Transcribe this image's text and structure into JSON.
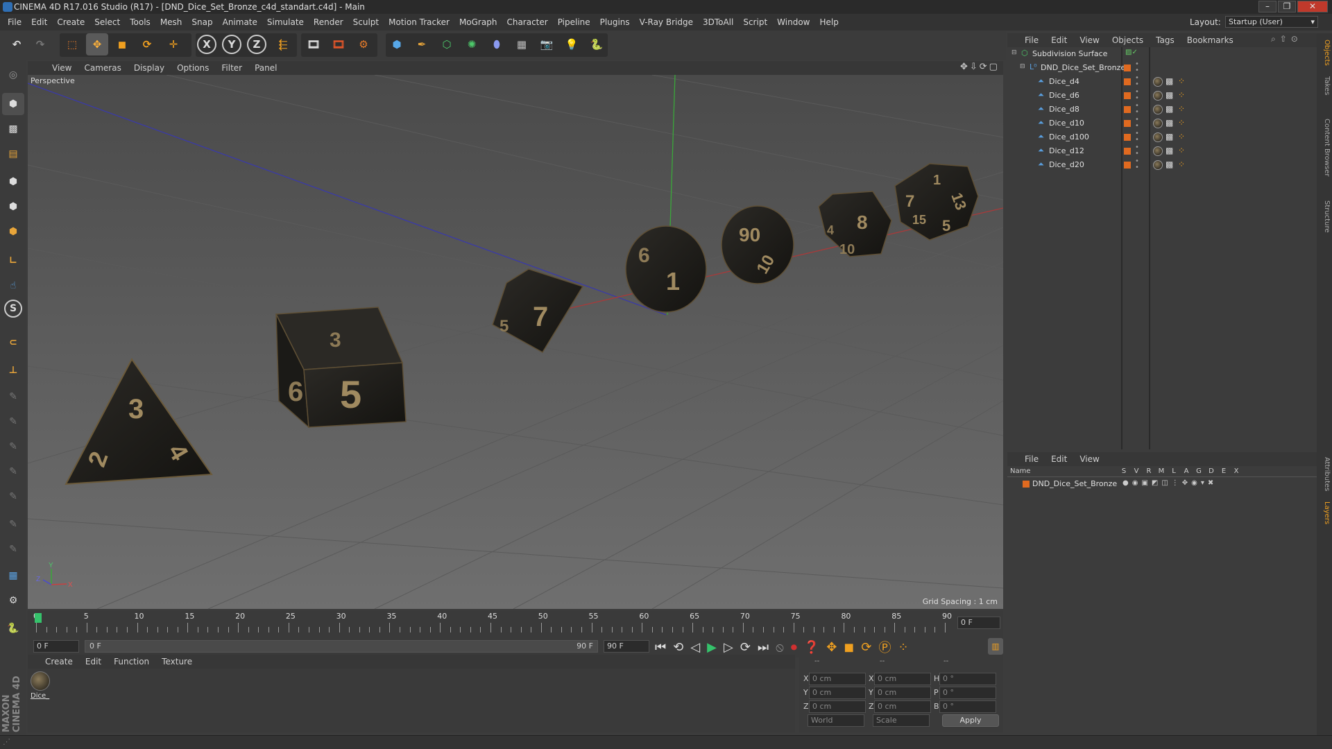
{
  "window": {
    "title": "CINEMA 4D R17.016 Studio (R17) - [DND_Dice_Set_Bronze_c4d_standart.c4d] - Main",
    "minimize": "–",
    "maximize": "❐",
    "close": "✕"
  },
  "menu": [
    "File",
    "Edit",
    "Create",
    "Select",
    "Tools",
    "Mesh",
    "Snap",
    "Animate",
    "Simulate",
    "Render",
    "Sculpt",
    "Motion Tracker",
    "MoGraph",
    "Character",
    "Pipeline",
    "Plugins",
    "V-Ray Bridge",
    "3DToAll",
    "Script",
    "Window",
    "Help"
  ],
  "layout": {
    "label": "Layout:",
    "value": "Startup (User)"
  },
  "toolbar": {
    "axis_x": "X",
    "axis_y": "Y",
    "axis_z": "Z"
  },
  "viewport": {
    "menu": [
      "View",
      "Cameras",
      "Display",
      "Options",
      "Filter",
      "Panel"
    ],
    "label": "Perspective",
    "grid_spacing": "Grid Spacing : 1 cm",
    "dice_numbers": {
      "d4": [
        "3",
        "2",
        "4"
      ],
      "d6": [
        "3",
        "6",
        "5"
      ],
      "d8": [
        "7",
        "5"
      ],
      "d10": [
        "6",
        "1"
      ],
      "d100": [
        "90",
        "10"
      ],
      "d12": [
        "8",
        "4",
        "10"
      ],
      "d20": [
        "1",
        "7",
        "13",
        "15",
        "5"
      ]
    },
    "axis_y": "Y",
    "axis_x": "X",
    "axis_z": "Z"
  },
  "timeline": {
    "ticks": [
      "0",
      "5",
      "10",
      "15",
      "20",
      "25",
      "30",
      "35",
      "40",
      "45",
      "50",
      "55",
      "60",
      "65",
      "70",
      "75",
      "80",
      "85",
      "90"
    ],
    "current_frame": "0 F",
    "start_field": "0 F",
    "range_start": "0 F",
    "range_end": "90 F",
    "end_field": "90 F"
  },
  "objects": {
    "menu": [
      "File",
      "Edit",
      "View",
      "Objects",
      "Tags",
      "Bookmarks"
    ],
    "items": [
      {
        "name": "Subdivision Surface",
        "indent": 0
      },
      {
        "name": "DND_Dice_Set_Bronze",
        "indent": 1
      },
      {
        "name": "Dice_d4",
        "indent": 2
      },
      {
        "name": "Dice_d6",
        "indent": 2
      },
      {
        "name": "Dice_d8",
        "indent": 2
      },
      {
        "name": "Dice_d10",
        "indent": 2
      },
      {
        "name": "Dice_d100",
        "indent": 2
      },
      {
        "name": "Dice_d12",
        "indent": 2
      },
      {
        "name": "Dice_d20",
        "indent": 2
      }
    ]
  },
  "layers": {
    "menu": [
      "File",
      "Edit",
      "View"
    ],
    "name_header": "Name",
    "flag_headers": [
      "S",
      "V",
      "R",
      "M",
      "L",
      "A",
      "G",
      "D",
      "E",
      "X"
    ],
    "rows": [
      {
        "name": "DND_Dice_Set_Bronze"
      }
    ]
  },
  "materials": {
    "menu": [
      "Create",
      "Edit",
      "Function",
      "Texture"
    ],
    "items": [
      {
        "name": "Dice_"
      }
    ]
  },
  "coords": {
    "headers": [
      "--",
      "--",
      "--"
    ],
    "rows": [
      {
        "a": "X",
        "av": "0 cm",
        "b": "X",
        "bv": "0 cm",
        "c": "H",
        "cv": "0 °"
      },
      {
        "a": "Y",
        "av": "0 cm",
        "b": "Y",
        "bv": "0 cm",
        "c": "P",
        "cv": "0 °"
      },
      {
        "a": "Z",
        "av": "0 cm",
        "b": "Z",
        "bv": "0 cm",
        "c": "B",
        "cv": "0 °"
      }
    ],
    "world": "World",
    "scale": "Scale",
    "apply": "Apply"
  },
  "right_tabs": [
    "Objects",
    "Takes",
    "Content Browser",
    "Structure",
    "Attributes",
    "Layers"
  ],
  "brand": "MAXON CINEMA 4D"
}
